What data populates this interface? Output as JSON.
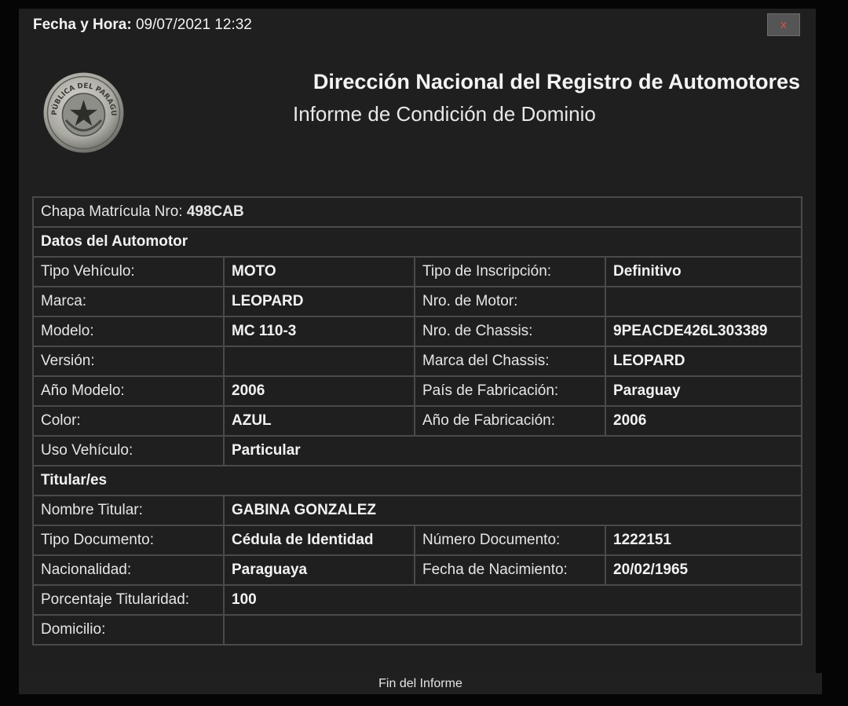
{
  "header": {
    "datetime_label": "Fecha y Hora:",
    "datetime_value": "09/07/2021 12:32",
    "close_label": "x",
    "title": "Dirección Nacional del Registro de Automotores",
    "subtitle": "Informe de Condición de Dominio",
    "seal_text": "REPÚBLICA DEL PARAGUAY"
  },
  "plate": {
    "label": "Chapa Matrícula Nro:",
    "value": "498CAB"
  },
  "vehicle": {
    "section_title": "Datos del Automotor",
    "tipo_vehiculo": {
      "label": "Tipo Vehículo:",
      "value": "MOTO"
    },
    "tipo_inscripcion": {
      "label": "Tipo de Inscripción:",
      "value": "Definitivo"
    },
    "marca": {
      "label": "Marca:",
      "value": "LEOPARD"
    },
    "nro_motor": {
      "label": "Nro. de Motor:",
      "value": ""
    },
    "modelo": {
      "label": "Modelo:",
      "value": "MC 110-3"
    },
    "nro_chassis": {
      "label": "Nro. de Chassis:",
      "value": "9PEACDE426L303389"
    },
    "version": {
      "label": "Versión:",
      "value": ""
    },
    "marca_chassis": {
      "label": "Marca del Chassis:",
      "value": "LEOPARD"
    },
    "anio_modelo": {
      "label": "Año Modelo:",
      "value": "2006"
    },
    "pais_fabricacion": {
      "label": "País de Fabricación:",
      "value": "Paraguay"
    },
    "color": {
      "label": "Color:",
      "value": "AZUL"
    },
    "anio_fabricacion": {
      "label": "Año de Fabricación:",
      "value": "2006"
    },
    "uso_vehiculo": {
      "label": "Uso Vehículo:",
      "value": "Particular"
    }
  },
  "owner": {
    "section_title": "Titular/es",
    "nombre": {
      "label": "Nombre Titular:",
      "value": "GABINA GONZALEZ"
    },
    "tipo_documento": {
      "label": "Tipo Documento:",
      "value": "Cédula de Identidad"
    },
    "numero_documento": {
      "label": "Número Documento:",
      "value": "1222151"
    },
    "nacionalidad": {
      "label": "Nacionalidad:",
      "value": "Paraguaya"
    },
    "fecha_nacimiento": {
      "label": "Fecha de Nacimiento:",
      "value": "20/02/1965"
    },
    "porcentaje": {
      "label": "Porcentaje Titularidad:",
      "value": "100"
    },
    "domicilio": {
      "label": "Domicilio:",
      "value": ""
    }
  },
  "footer": {
    "text": "Fin del Informe"
  }
}
